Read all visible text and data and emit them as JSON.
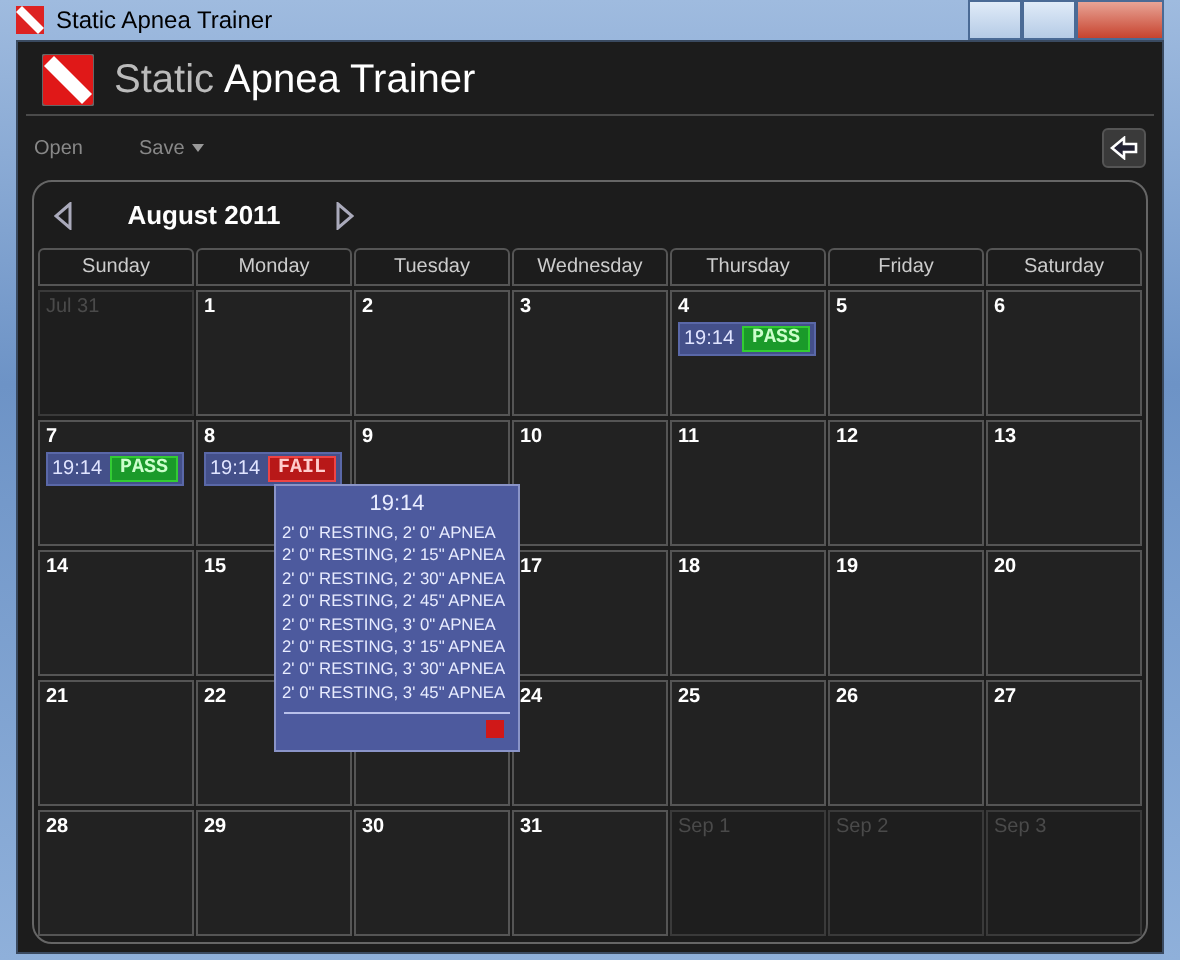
{
  "window": {
    "title": "Static Apnea Trainer"
  },
  "header": {
    "title_light": "Static",
    "title_bold": "Apnea Trainer"
  },
  "toolbar": {
    "open": "Open",
    "save": "Save"
  },
  "calendar": {
    "month": "August 2011",
    "weekdays": [
      "Sunday",
      "Monday",
      "Tuesday",
      "Wednesday",
      "Thursday",
      "Friday",
      "Saturday"
    ],
    "weeks": [
      {
        "sun": {
          "label": "Jul 31",
          "in_month": false
        },
        "mon": {
          "label": "1",
          "in_month": true
        },
        "tue": {
          "label": "2",
          "in_month": true
        },
        "wed": {
          "label": "3",
          "in_month": true
        },
        "thu": {
          "label": "4",
          "in_month": true,
          "events": [
            {
              "time": "19:14",
              "result": "PASS",
              "kind": "pass"
            }
          ]
        },
        "fri": {
          "label": "5",
          "in_month": true
        },
        "sat": {
          "label": "6",
          "in_month": true
        }
      },
      {
        "sun": {
          "label": "7",
          "in_month": true,
          "events": [
            {
              "time": "19:14",
              "result": "PASS",
              "kind": "pass"
            }
          ]
        },
        "mon": {
          "label": "8",
          "in_month": true,
          "events": [
            {
              "time": "19:14",
              "result": "FAIL",
              "kind": "fail"
            }
          ]
        },
        "tue": {
          "label": "9",
          "in_month": true
        },
        "wed": {
          "label": "10",
          "in_month": true
        },
        "thu": {
          "label": "11",
          "in_month": true
        },
        "fri": {
          "label": "12",
          "in_month": true
        },
        "sat": {
          "label": "13",
          "in_month": true
        }
      },
      {
        "sun": {
          "label": "14",
          "in_month": true
        },
        "mon": {
          "label": "15",
          "in_month": true
        },
        "wed": {
          "label": "17",
          "in_month": true
        },
        "thu": {
          "label": "18",
          "in_month": true
        },
        "fri": {
          "label": "19",
          "in_month": true
        },
        "sat": {
          "label": "20",
          "in_month": true
        }
      },
      {
        "sun": {
          "label": "21",
          "in_month": true
        },
        "mon": {
          "label": "22",
          "in_month": true
        },
        "tue": {
          "in_month": true
        },
        "wed": {
          "label": "24",
          "in_month": true
        },
        "thu": {
          "label": "25",
          "in_month": true
        },
        "fri": {
          "label": "26",
          "in_month": true
        },
        "sat": {
          "label": "27",
          "in_month": true
        }
      },
      {
        "sun": {
          "label": "28",
          "in_month": true
        },
        "mon": {
          "label": "29",
          "in_month": true
        },
        "tue": {
          "label": "30",
          "in_month": true
        },
        "wed": {
          "label": "31",
          "in_month": true
        },
        "thu": {
          "label": "Sep 1",
          "in_month": false
        },
        "fri": {
          "label": "Sep 2",
          "in_month": false
        },
        "sat": {
          "label": "Sep 3",
          "in_month": false
        }
      }
    ]
  },
  "popup": {
    "title": "19:14",
    "lines": [
      "2' 0\" RESTING, 2' 0\" APNEA",
      "2' 0\" RESTING, 2' 15\" APNEA",
      "2' 0\" RESTING, 2' 30\" APNEA",
      "2' 0\" RESTING, 2' 45\" APNEA",
      "2' 0\" RESTING, 3' 0\" APNEA",
      "2' 0\" RESTING, 3' 15\" APNEA",
      "2' 0\" RESTING, 3' 30\" APNEA",
      "2' 0\" RESTING, 3' 45\" APNEA"
    ]
  }
}
